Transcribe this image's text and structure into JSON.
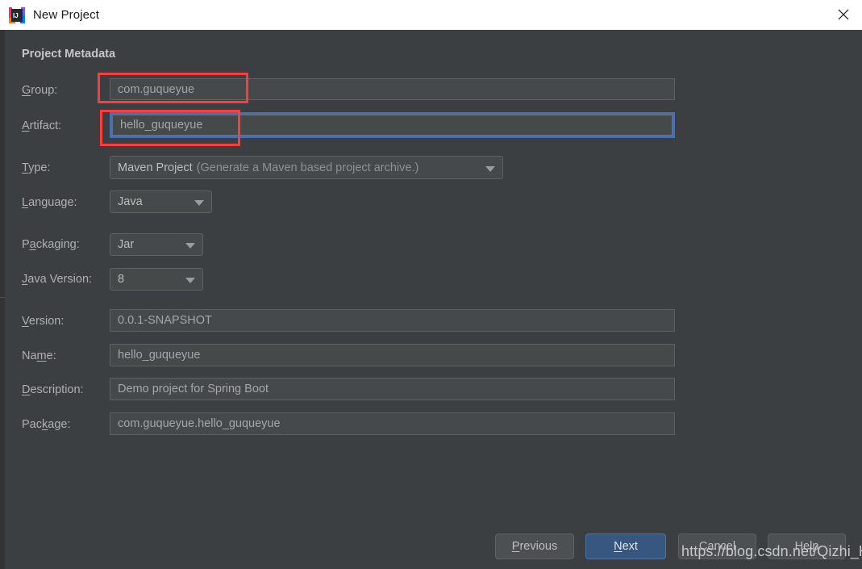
{
  "window": {
    "title": "New Project",
    "app_icon": "intellij-idea-icon",
    "close_icon": "close-icon"
  },
  "section": {
    "heading": "Project Metadata"
  },
  "fields": [
    {
      "id": "group",
      "label_pre": "",
      "label_mnemonic": "G",
      "label_post": "roup:",
      "value": "com.guqueyue",
      "kind": "text"
    },
    {
      "id": "artifact",
      "label_pre": "",
      "label_mnemonic": "A",
      "label_post": "rtifact:",
      "value": "hello_guqueyue",
      "kind": "text"
    },
    {
      "id": "type",
      "label_pre": "",
      "label_mnemonic": "T",
      "label_post": "ype:",
      "value": "Maven Project",
      "value_hint": "(Generate a Maven based project archive.)",
      "kind": "combo"
    },
    {
      "id": "language",
      "label_pre": "",
      "label_mnemonic": "L",
      "label_post": "anguage:",
      "value": "Java",
      "kind": "combo"
    },
    {
      "id": "packaging",
      "label_pre": "P",
      "label_mnemonic": "a",
      "label_post": "ckaging:",
      "value": "Jar",
      "kind": "combo"
    },
    {
      "id": "java-version",
      "label_pre": "",
      "label_mnemonic": "J",
      "label_post": "ava Version:",
      "value": "8",
      "kind": "combo"
    },
    {
      "id": "version",
      "label_pre": "",
      "label_mnemonic": "V",
      "label_post": "ersion:",
      "value": "0.0.1-SNAPSHOT",
      "kind": "text"
    },
    {
      "id": "name",
      "label_pre": "Na",
      "label_mnemonic": "m",
      "label_post": "e:",
      "value": "hello_guqueyue",
      "kind": "text"
    },
    {
      "id": "description",
      "label_pre": "",
      "label_mnemonic": "D",
      "label_post": "escription:",
      "value": "Demo project for Spring Boot",
      "kind": "text"
    },
    {
      "id": "package",
      "label_pre": "Pac",
      "label_mnemonic": "k",
      "label_post": "age:",
      "value": "com.guqueyue.hello_guqueyue",
      "kind": "text"
    }
  ],
  "buttons": [
    {
      "id": "previous",
      "pre": "",
      "mnemonic": "P",
      "post": "revious",
      "primary": false
    },
    {
      "id": "next",
      "pre": "",
      "mnemonic": "N",
      "post": "ext",
      "primary": true
    },
    {
      "id": "cancel",
      "pre": "Cancel",
      "mnemonic": "",
      "post": "",
      "primary": false
    },
    {
      "id": "help",
      "pre": "Help",
      "mnemonic": "",
      "post": "",
      "primary": false
    }
  ],
  "annotations": [
    {
      "id": "group-highlight",
      "color": "#fc3d3d"
    },
    {
      "id": "artifact-highlight",
      "color": "#fc3d3d"
    }
  ],
  "watermark": {
    "text": "https://blog.csdn.net/Qizhi_Hu"
  },
  "colors": {
    "background": "#3c3f41",
    "field_bg": "#45494a",
    "accent_blue": "#4b6eaf",
    "primary_button": "#365880",
    "annotation_red": "#fc3d3d",
    "titlebar_bg": "#ffffff"
  }
}
